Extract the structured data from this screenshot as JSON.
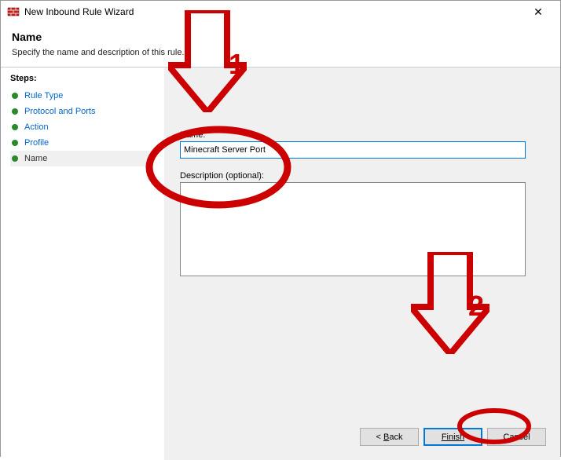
{
  "window": {
    "title": "New Inbound Rule Wizard"
  },
  "header": {
    "title": "Name",
    "subtitle": "Specify the name and description of this rule."
  },
  "sidebar": {
    "title": "Steps:",
    "items": [
      {
        "label": "Rule Type",
        "current": false
      },
      {
        "label": "Protocol and Ports",
        "current": false
      },
      {
        "label": "Action",
        "current": false
      },
      {
        "label": "Profile",
        "current": false
      },
      {
        "label": "Name",
        "current": true
      }
    ]
  },
  "form": {
    "name_label": "Name:",
    "name_value": "Minecraft Server Port",
    "description_label": "Description (optional):",
    "description_value": ""
  },
  "buttons": {
    "back": "Back",
    "finish": "Finish",
    "cancel": "Cancel"
  },
  "annotations": {
    "number1": "1",
    "number2": "2",
    "color": "#cc0000"
  }
}
